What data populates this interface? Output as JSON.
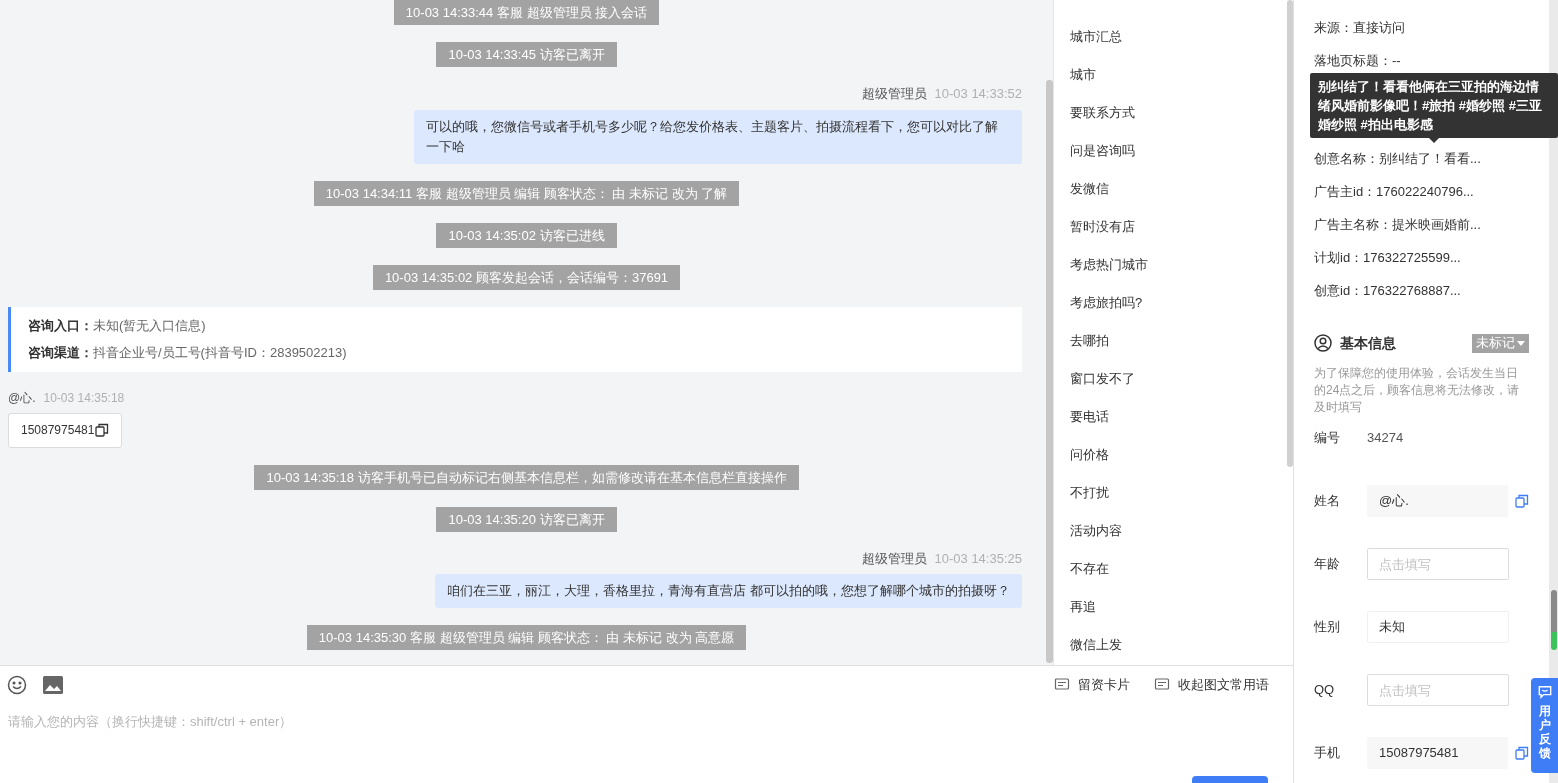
{
  "chat": {
    "messages": [
      {
        "kind": "notice",
        "text": "10-03 14:33:44 客服 超级管理员 接入会话"
      },
      {
        "kind": "notice",
        "text": "10-03 14:33:45 访客已离开"
      },
      {
        "kind": "agent",
        "sender": "超级管理员",
        "time": "10-03 14:33:52",
        "text": "可以的哦，您微信号或者手机号多少呢？给您发价格表、主题客片、拍摄流程看下，您可以对比了解一下哈"
      },
      {
        "kind": "notice",
        "text": "10-03 14:34:11 客服 超级管理员 编辑 顾客状态： 由 未标记 改为 了解"
      },
      {
        "kind": "notice",
        "text": "10-03 14:35:02 访客已进线"
      },
      {
        "kind": "notice",
        "text": "10-03 14:35:02 顾客发起会话，会话编号：37691"
      },
      {
        "kind": "entry_card",
        "rows": [
          {
            "label": "咨询入口：",
            "value": "未知(暂无入口信息)"
          },
          {
            "label": "咨询渠道：",
            "value": "抖音企业号/员工号(抖音号ID：2839502213)"
          }
        ]
      },
      {
        "kind": "visitor",
        "sender": "@心.",
        "time": "10-03 14:35:18",
        "text": "15087975481"
      },
      {
        "kind": "notice",
        "text": "10-03 14:35:18 访客手机号已自动标记右侧基本信息栏，如需修改请在基本信息栏直接操作"
      },
      {
        "kind": "notice",
        "text": "10-03 14:35:20 访客已离开"
      },
      {
        "kind": "agent",
        "sender": "超级管理员",
        "time": "10-03 14:35:25",
        "text": "咱们在三亚，丽江，大理，香格里拉，青海有直营店 都可以拍的哦，您想了解哪个城市的拍摄呀？"
      },
      {
        "kind": "notice",
        "text": "10-03 14:35:30 客服 超级管理员 编辑 顾客状态： 由 未标记 改为 高意愿"
      }
    ]
  },
  "composer": {
    "placeholder": "请输入您的内容（换行快捷键：shift/ctrl + enter）",
    "actions": [
      "留资卡片",
      "收起图文常用语"
    ]
  },
  "quick_replies": [
    "城市汇总",
    "城市",
    "要联系方式",
    "问是咨询吗",
    "发微信",
    "暂时没有店",
    "考虑热门城市",
    "考虑旅拍吗?",
    "去哪拍",
    "窗口发不了",
    "要电话",
    "问价格",
    "不打扰",
    "活动内容",
    "不存在",
    "再追",
    "微信上发"
  ],
  "ad_info": {
    "rows_above": [
      "来源：直接访问",
      "落地页标题：--"
    ],
    "tooltip": "别纠结了！看看他俩在三亚拍的海边情绪风婚前影像吧！#旅拍 #婚纱照 #三亚婚纱照 #拍出电影感",
    "rows_below": [
      "创意名称：别纠结了！看看...",
      "广告主id：176022240796...",
      "广告主名称：提米映画婚前...",
      "计划id：176322725599...",
      "创意id：176322768887..."
    ]
  },
  "basic_info": {
    "title": "基本信息",
    "status": "未标记",
    "notice": "为了保障您的使用体验，会话发生当日的24点之后，顾客信息将无法修改，请及时填写",
    "fields": [
      {
        "label": "编号",
        "kind": "static",
        "value": "34274"
      },
      {
        "label": "姓名",
        "kind": "readonly",
        "value": "@心."
      },
      {
        "label": "年龄",
        "kind": "input",
        "placeholder": "点击填写"
      },
      {
        "label": "性别",
        "kind": "select",
        "value": "未知"
      },
      {
        "label": "QQ",
        "kind": "input",
        "placeholder": "点击填写"
      },
      {
        "label": "手机",
        "kind": "readonly",
        "value": "15087975481"
      }
    ]
  },
  "feedback_button": "用户反馈"
}
